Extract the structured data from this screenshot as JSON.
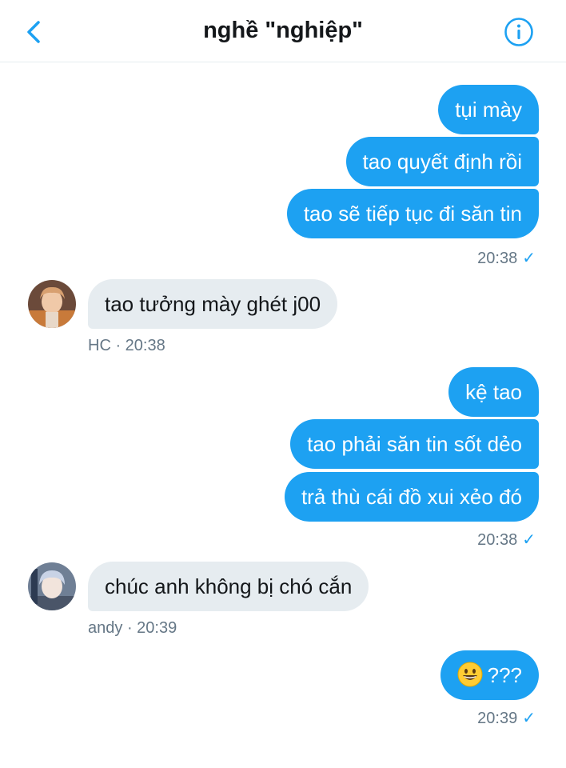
{
  "header": {
    "title": "nghề \"nghiệp\"",
    "back_icon": "chevron-left-icon",
    "info_icon": "info-circle-icon"
  },
  "colors": {
    "accent": "#1da1f2",
    "incoming_bubble": "#e6ecf0",
    "meta_text": "#657786"
  },
  "messages": {
    "group1": {
      "lines": [
        "tụi mày",
        "tao quyết định rồi",
        "tao sẽ tiếp tục đi săn tin"
      ],
      "time": "20:38"
    },
    "reply1": {
      "text": "tao tưởng mày ghét j00",
      "sender": "HC",
      "time": "· 20:38"
    },
    "group2": {
      "lines": [
        "kệ tao",
        "tao phải săn tin sốt dẻo",
        "trả thù cái đồ xui xẻo đó"
      ],
      "time": "20:38"
    },
    "reply2": {
      "text": "chúc anh không bị chó cắn",
      "sender": "andy",
      "time": "· 20:39"
    },
    "group3": {
      "emoji": "grinning-face-emoji",
      "text": "???",
      "time": "20:39"
    }
  }
}
